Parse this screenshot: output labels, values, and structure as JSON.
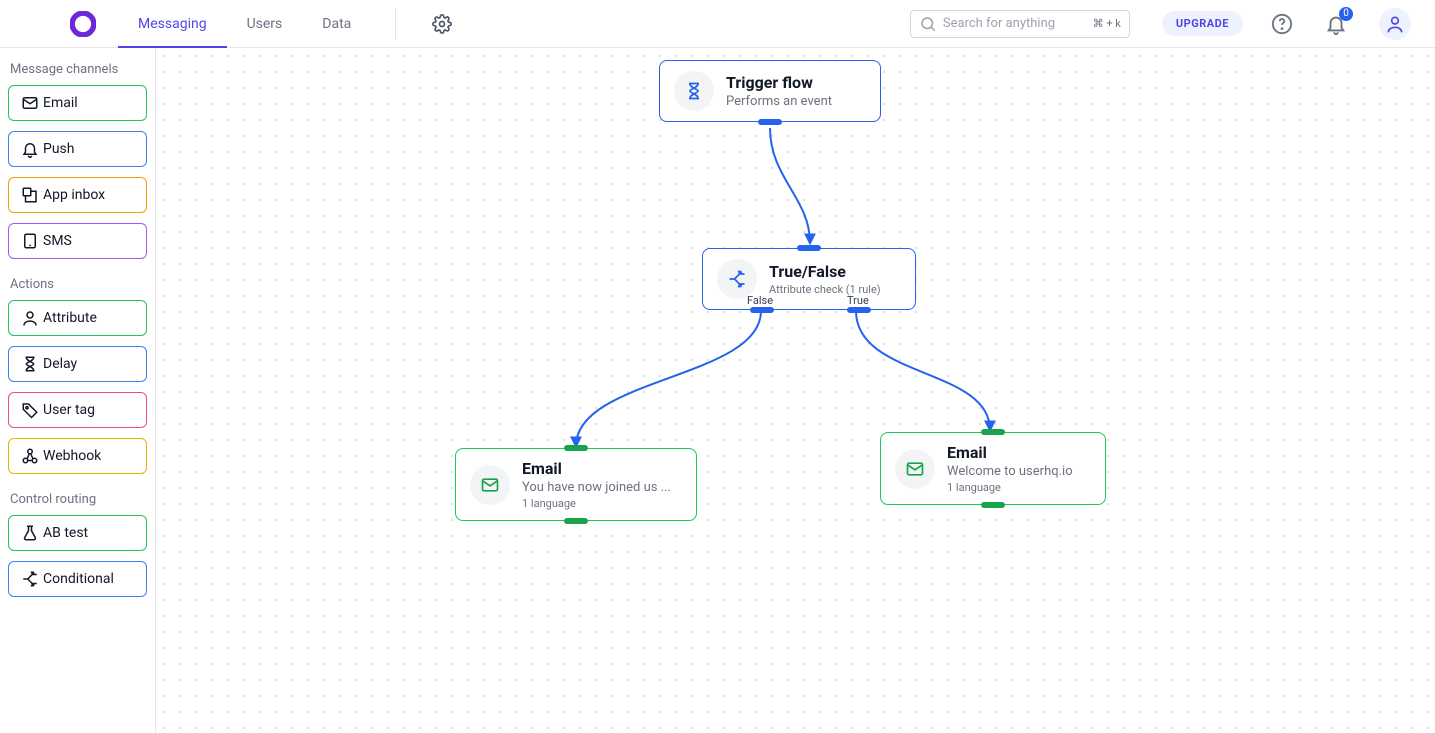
{
  "header": {
    "nav": [
      "Messaging",
      "Users",
      "Data"
    ],
    "active_nav": 0,
    "search_placeholder": "Search for anything",
    "search_shortcut": "⌘ + k",
    "upgrade_label": "UPGRADE",
    "notification_count": "0"
  },
  "sidebar": {
    "groups": [
      {
        "title": "Message channels",
        "items": [
          {
            "label": "Email",
            "color": "green",
            "icon": "mail"
          },
          {
            "label": "Push",
            "color": "blue",
            "icon": "bell"
          },
          {
            "label": "App inbox",
            "color": "orange",
            "icon": "inbox"
          },
          {
            "label": "SMS",
            "color": "purple",
            "icon": "sms"
          }
        ]
      },
      {
        "title": "Actions",
        "items": [
          {
            "label": "Attribute",
            "color": "green",
            "icon": "attribute"
          },
          {
            "label": "Delay",
            "color": "blue",
            "icon": "hourglass"
          },
          {
            "label": "User tag",
            "color": "pink",
            "icon": "tag"
          },
          {
            "label": "Webhook",
            "color": "yellow",
            "icon": "webhook"
          }
        ]
      },
      {
        "title": "Control routing",
        "items": [
          {
            "label": "AB test",
            "color": "green",
            "icon": "abtest"
          },
          {
            "label": "Conditional",
            "color": "blue",
            "icon": "conditional"
          }
        ]
      }
    ]
  },
  "flow": {
    "trigger": {
      "title": "Trigger flow",
      "subtitle": "Performs an event"
    },
    "condition": {
      "title": "True/False",
      "subtitle": "Attribute check (1 rule)",
      "port_false": "False",
      "port_true": "True"
    },
    "email_false": {
      "title": "Email",
      "subtitle": "You have now joined us ...",
      "meta": "1 language"
    },
    "email_true": {
      "title": "Email",
      "subtitle": "Welcome to userhq.io",
      "meta": "1 language"
    }
  }
}
